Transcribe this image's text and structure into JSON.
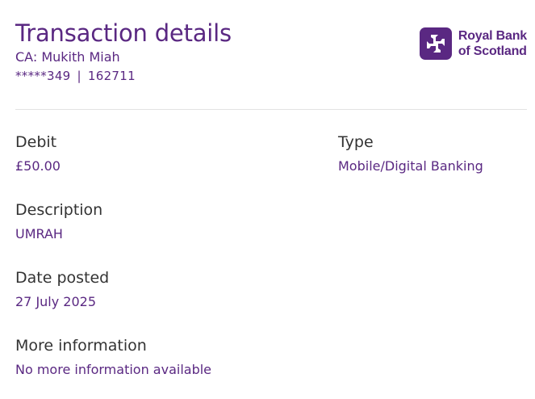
{
  "header": {
    "title": "Transaction details",
    "account_name": "CA: Mukith Miah",
    "account_number": "*****349",
    "separator": "|",
    "sort_code": "162711"
  },
  "brand": {
    "line1": "Royal Bank",
    "line2": "of Scotland",
    "logo_icon": "rbs-daisy-logo-icon",
    "color": "#5a2882"
  },
  "fields": {
    "debit": {
      "label": "Debit",
      "value": "£50.00"
    },
    "type": {
      "label": "Type",
      "value": "Mobile/Digital Banking"
    },
    "description": {
      "label": "Description",
      "value": "UMRAH"
    },
    "date_posted": {
      "label": "Date posted",
      "value": "27 July 2025"
    },
    "more_info": {
      "label": "More information",
      "value": "No more information available"
    }
  }
}
